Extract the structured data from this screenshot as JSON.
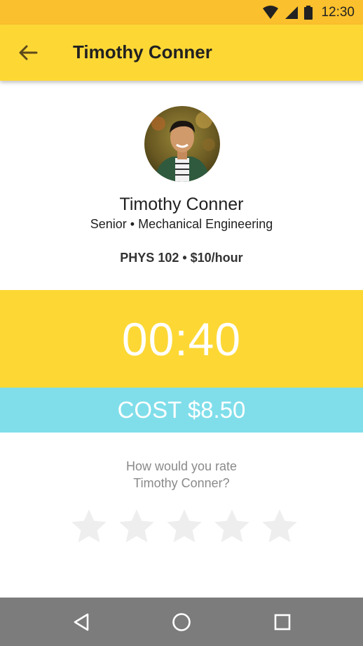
{
  "status_bar": {
    "time": "12:30",
    "icons": [
      "wifi-icon",
      "signal-icon",
      "battery-icon"
    ]
  },
  "app_bar": {
    "title": "Timothy Conner",
    "back_icon": "arrow-back-icon"
  },
  "profile": {
    "name": "Timothy Conner",
    "subtitle": "Senior • Mechanical Engineering",
    "course": "PHYS 102 • $10/hour"
  },
  "session": {
    "timer": "00:40",
    "cost": "COST $8.50"
  },
  "rating": {
    "question_line1": "How would you rate",
    "question_line2": "Timothy Conner?",
    "max_stars": 5,
    "selected": 0
  },
  "nav": {
    "icons": [
      "back-triangle-icon",
      "home-circle-icon",
      "recents-square-icon"
    ]
  },
  "colors": {
    "primary": "#fdd835",
    "status": "#fbc02d",
    "accent": "#80deea",
    "nav": "#7c7c7c",
    "star_empty": "#eeeeee"
  }
}
